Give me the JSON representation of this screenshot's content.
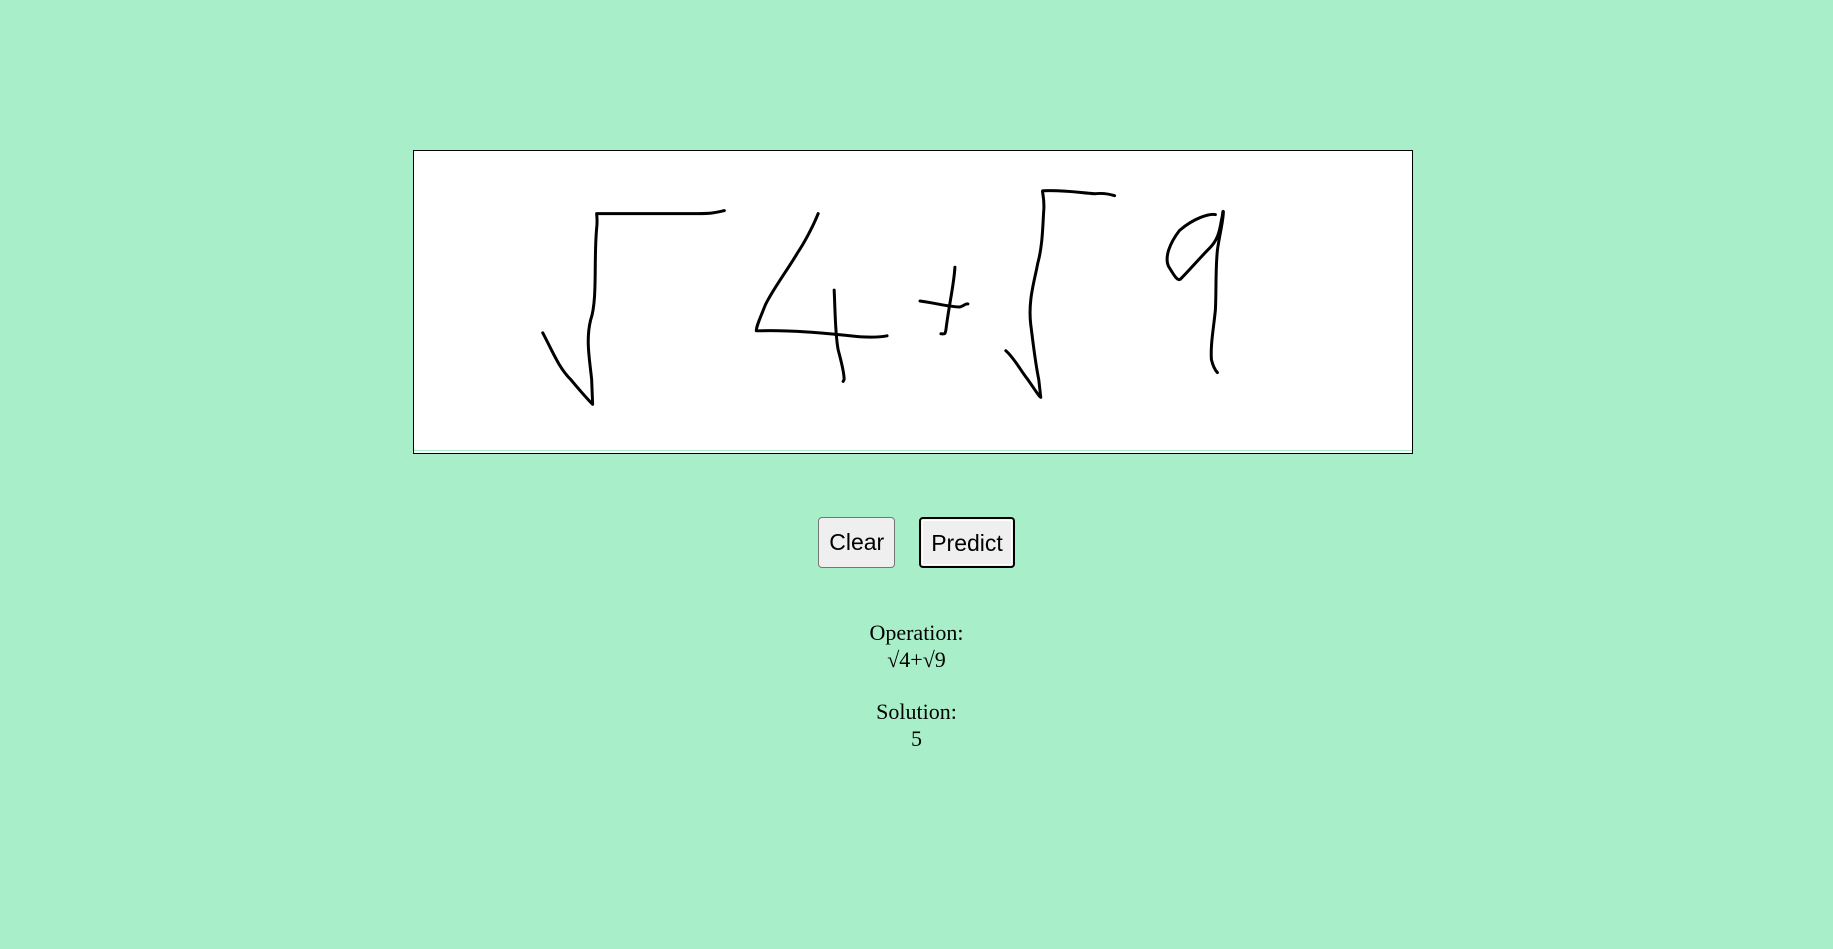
{
  "canvas": {
    "strokes": [
      "M542,333 C552,352 558,368 570,380 C580,392 585,398 592,405 L591,380 C589,360 585,340 590,320 C597,300 593,260 596,228 C597,220 596,214 596,213 L698,213 C710,213 716,212 724,210",
      "M818,213 C812,228 803,244 797,253 C787,270 772,290 765,305 C760,318 756,326 756,331 L758,331 C795,330 830,334 860,337 C875,338 882,337 887,336",
      "M834,290 C835,310 835,335 838,350 C841,362 844,372 844,380 L843,382",
      "M920,301 C935,303 950,307 960,307 C964,306 966,303 968,304",
      "M955,267 C954,285 949,305 946,330 C945,335 945,334 941,334",
      "M1006,351 C1015,359 1020,370 1028,380 C1035,390 1040,398 1041,398 L1039,380 C1035,360 1033,340 1031,325 C1028,300 1035,280 1038,263 C1043,245 1043,224 1044,210 C1045,198 1042,190 1043,190 C1065,189 1080,192 1095,193 C1105,192 1112,194 1115,195",
      "M1216,214 C1210,213 1195,217 1180,230 C1170,243 1165,257 1169,266 C1175,276 1178,281 1181,279 C1190,270 1200,258 1210,248 C1218,240 1220,232 1222,220 C1224,212 1223,210 1224,211 C1224,220 1220,235 1218,250 C1216,270 1217,290 1216,310 C1214,330 1211,345 1212,360 C1214,368 1216,371 1218,373"
    ]
  },
  "buttons": {
    "clear_label": "Clear",
    "predict_label": "Predict"
  },
  "operation": {
    "label": "Operation:",
    "value": "√4+√9"
  },
  "solution": {
    "label": "Solution:",
    "value": "5"
  }
}
